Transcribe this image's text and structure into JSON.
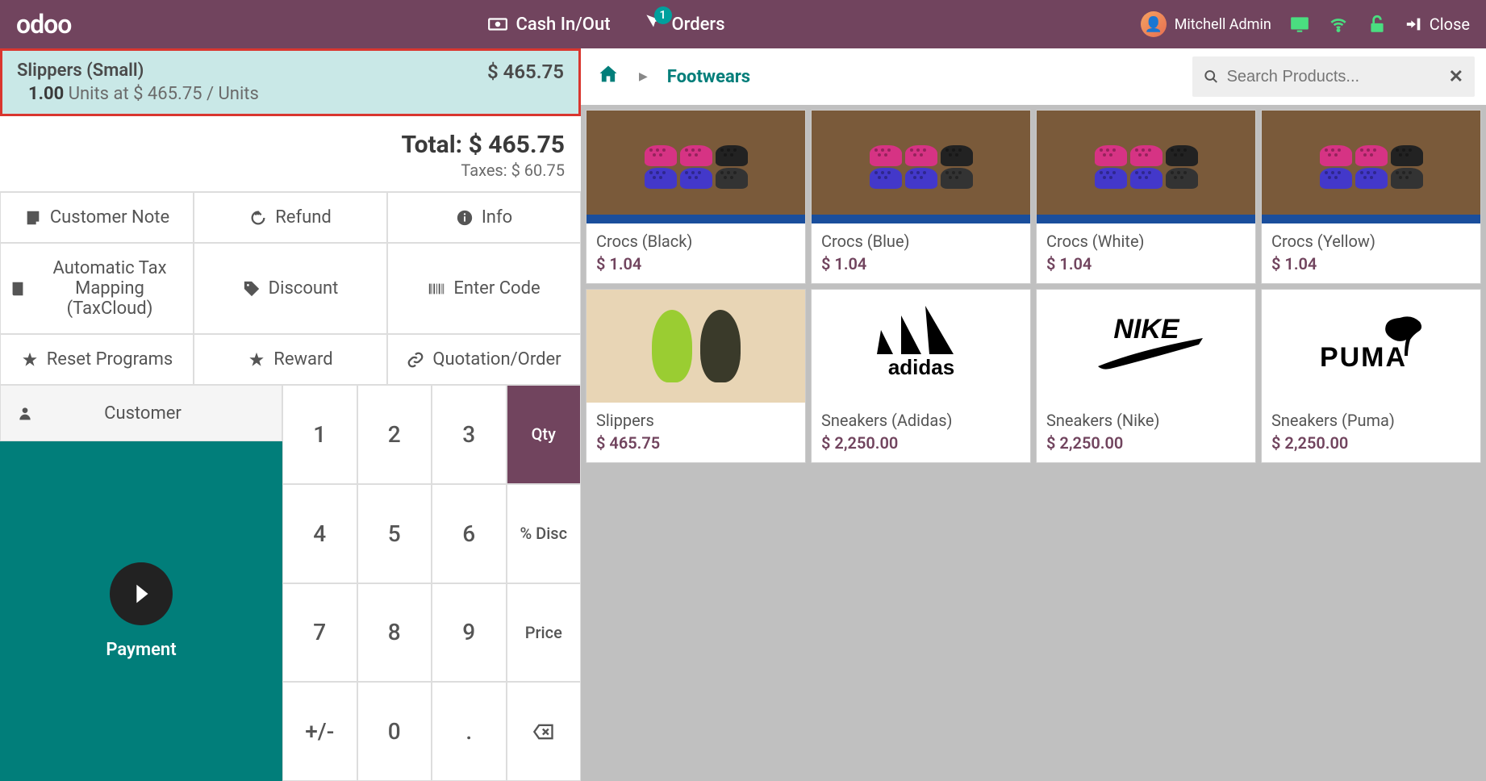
{
  "header": {
    "logo": "odoo",
    "cash_in_out": "Cash In/Out",
    "orders": "Orders",
    "orders_count": "1",
    "user_name": "Mitchell Admin",
    "close": "Close"
  },
  "orderline": {
    "name": "Slippers (Small)",
    "qty": "1.00",
    "units_label": " Units at $ 465.75 / Units",
    "price": "$ 465.75"
  },
  "totals": {
    "total_label": "Total: ",
    "total_value": "$ 465.75",
    "taxes_label": "Taxes: ",
    "taxes_value": "$ 60.75"
  },
  "controls": {
    "customer_note": "Customer Note",
    "refund": "Refund",
    "info": "Info",
    "auto_tax": "Automatic Tax Mapping (TaxCloud)",
    "discount": "Discount",
    "enter_code": "Enter Code",
    "reset_programs": "Reset Programs",
    "reward": "Reward",
    "quotation": "Quotation/Order"
  },
  "customer_btn": "Customer",
  "payment_btn": "Payment",
  "numpad": {
    "n1": "1",
    "n2": "2",
    "n3": "3",
    "n4": "4",
    "n5": "5",
    "n6": "6",
    "n7": "7",
    "n8": "8",
    "n9": "9",
    "n0": "0",
    "plusminus": "+/-",
    "dot": ".",
    "qty": "Qty",
    "disc": "% Disc",
    "price": "Price"
  },
  "breadcrumb": {
    "current": "Footwears"
  },
  "search": {
    "placeholder": "Search Products..."
  },
  "products": [
    {
      "name": "Crocs (Black)",
      "price": "$ 1.04"
    },
    {
      "name": "Crocs (Blue)",
      "price": "$ 1.04"
    },
    {
      "name": "Crocs (White)",
      "price": "$ 1.04"
    },
    {
      "name": "Crocs (Yellow)",
      "price": "$ 1.04"
    },
    {
      "name": "Slippers",
      "price": "$ 465.75"
    },
    {
      "name": "Sneakers (Adidas)",
      "price": "$ 2,250.00"
    },
    {
      "name": "Sneakers (Nike)",
      "price": "$ 2,250.00"
    },
    {
      "name": "Sneakers (Puma)",
      "price": "$ 2,250.00"
    }
  ]
}
